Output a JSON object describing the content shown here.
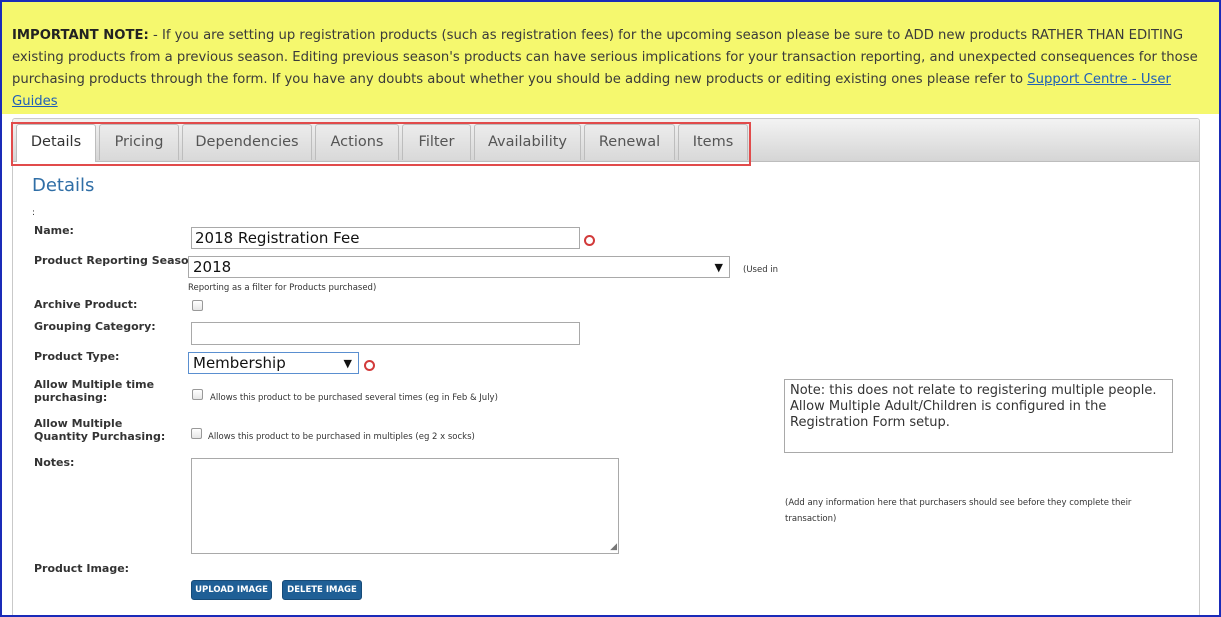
{
  "note": {
    "label": "IMPORTANT NOTE:",
    "text": " - If you are setting up registration products (such as registration fees) for the upcoming season please be sure to ADD new products RATHER THAN EDITING existing products from a previous season. Editing previous season's products can have serious implications for your transaction reporting, and unexpected consequences for those purchasing products through the form. If you have any doubts about whether you should be adding new products or editing existing ones please refer to ",
    "link": "Support Centre - User Guides"
  },
  "tabs": [
    "Details",
    "Pricing",
    "Dependencies",
    "Actions",
    "Filter",
    "Availability",
    "Renewal",
    "Items"
  ],
  "section_title": "Details",
  "colon": ":",
  "form": {
    "name_label": "Name:",
    "name_value": "2018 Registration Fee",
    "season_label": "Product Reporting Season:",
    "season_value": "2018",
    "season_hint_right": "(Used in",
    "season_hint_below": "Reporting as a filter for Products purchased)",
    "archive_label": "Archive Product:",
    "grouping_label": "Grouping Category:",
    "grouping_value": "",
    "type_label": "Product Type:",
    "type_value": "Membership",
    "multi_time_label": "Allow Multiple time purchasing:",
    "multi_time_hint": "Allows this product to be purchased several times (eg in Feb & July)",
    "multi_qty_label": "Allow Multiple Quantity Purchasing:",
    "multi_qty_hint": "Allows this product to be purchased in multiples (eg 2 x socks)",
    "multi_note": "Note: this does not relate to registering multiple people.\nAllow Multiple Adult/Children is configured in the Registration Form setup.",
    "notes_label": "Notes:",
    "notes_hint": "(Add any information here that purchasers should see before they complete their transaction)",
    "image_label": "Product Image:",
    "upload_label": "UPLOAD IMAGE",
    "delete_label": "DELETE IMAGE"
  }
}
